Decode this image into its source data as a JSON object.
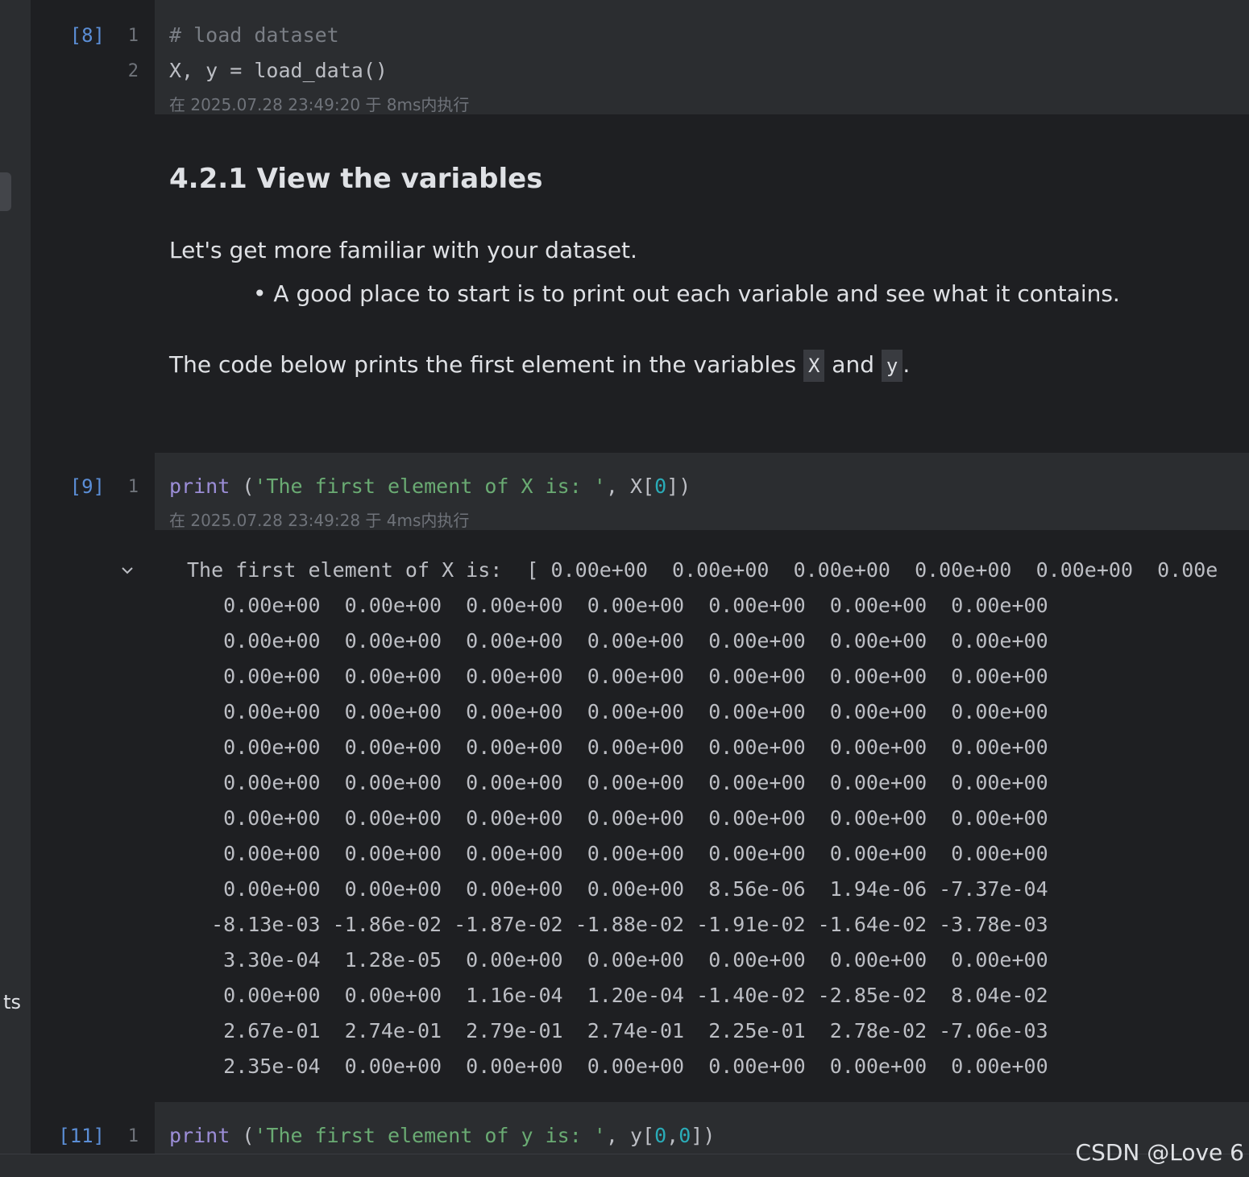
{
  "sidebar": {
    "clipped_label": "ts"
  },
  "cell8": {
    "prompt": "[8]",
    "lines": [
      "# load dataset",
      "X, y = load_data()"
    ],
    "exec_info": "在 2025.07.28 23:49:20 于 8ms内执行"
  },
  "markdown": {
    "heading": "4.2.1 View the variables",
    "para1": "Let's get more familiar with your dataset.",
    "bullet": "A good place to start is to print out each variable and see what it contains.",
    "para2_before": "The code below prints the first element in the variables ",
    "code_x": "X",
    "para2_mid": " and ",
    "code_y": "y",
    "para2_after": "."
  },
  "cell9": {
    "prompt": "[9]",
    "code_kw": "print",
    "code_str": "'The first element of X is: '",
    "code_rest_1": ", X[",
    "code_num": "0",
    "code_rest_2": "])",
    "exec_info": "在 2025.07.28 23:49:28 于 4ms内执行",
    "output": [
      "The first element of X is:  [ 0.00e+00  0.00e+00  0.00e+00  0.00e+00  0.00e+00  0.00e",
      "   0.00e+00  0.00e+00  0.00e+00  0.00e+00  0.00e+00  0.00e+00  0.00e+00",
      "   0.00e+00  0.00e+00  0.00e+00  0.00e+00  0.00e+00  0.00e+00  0.00e+00",
      "   0.00e+00  0.00e+00  0.00e+00  0.00e+00  0.00e+00  0.00e+00  0.00e+00",
      "   0.00e+00  0.00e+00  0.00e+00  0.00e+00  0.00e+00  0.00e+00  0.00e+00",
      "   0.00e+00  0.00e+00  0.00e+00  0.00e+00  0.00e+00  0.00e+00  0.00e+00",
      "   0.00e+00  0.00e+00  0.00e+00  0.00e+00  0.00e+00  0.00e+00  0.00e+00",
      "   0.00e+00  0.00e+00  0.00e+00  0.00e+00  0.00e+00  0.00e+00  0.00e+00",
      "   0.00e+00  0.00e+00  0.00e+00  0.00e+00  0.00e+00  0.00e+00  0.00e+00",
      "   0.00e+00  0.00e+00  0.00e+00  0.00e+00  8.56e-06  1.94e-06 -7.37e-04",
      "  -8.13e-03 -1.86e-02 -1.87e-02 -1.88e-02 -1.91e-02 -1.64e-02 -3.78e-03",
      "   3.30e-04  1.28e-05  0.00e+00  0.00e+00  0.00e+00  0.00e+00  0.00e+00",
      "   0.00e+00  0.00e+00  1.16e-04  1.20e-04 -1.40e-02 -2.85e-02  8.04e-02",
      "   2.67e-01  2.74e-01  2.79e-01  2.74e-01  2.25e-01  2.78e-02 -7.06e-03",
      "   2.35e-04  0.00e+00  0.00e+00  0.00e+00  0.00e+00  0.00e+00  0.00e+00"
    ]
  },
  "cell11": {
    "prompt": "[11]",
    "code_kw": "print",
    "code_str": "'The first element of y is: '",
    "code_rest_1": ", y[",
    "code_num_1": "0",
    "code_comma": ",",
    "code_num_2": "0",
    "code_rest_2": "])"
  },
  "line_numbers": {
    "one": "1",
    "two": "2"
  },
  "watermark": "CSDN @Love 6",
  "colors": {
    "background": "#1e1f22",
    "cell_bg": "#2b2d30",
    "keyword": "#9c8ed8",
    "string": "#6aab73",
    "number": "#2aacb8",
    "prompt": "#5b8ed6"
  }
}
